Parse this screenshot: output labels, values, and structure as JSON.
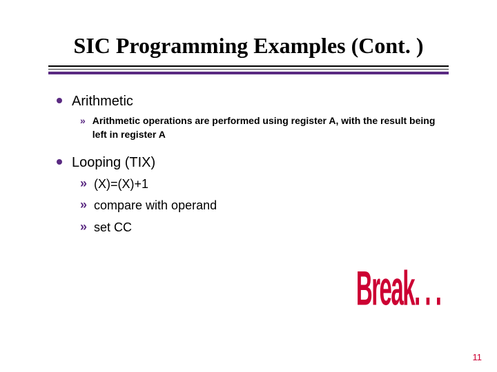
{
  "title": "SIC Programming Examples (Cont. )",
  "sections": [
    {
      "heading": "Arithmetic",
      "items": [
        {
          "text": "Arithmetic operations are performed using register A, with the result being left in register A",
          "style": "small"
        }
      ]
    },
    {
      "heading": "Looping (TIX)",
      "items": [
        {
          "text": "(X)=(X)+1",
          "style": "big"
        },
        {
          "text": "compare with operand",
          "style": "big"
        },
        {
          "text": "set CC",
          "style": "big"
        }
      ]
    }
  ],
  "break_label": "Break. . .",
  "page_number": "11",
  "bullet2_glyph": "»"
}
